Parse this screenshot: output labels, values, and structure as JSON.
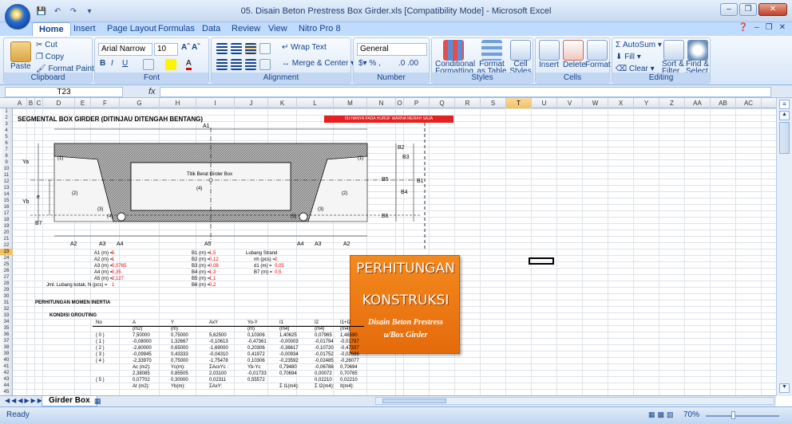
{
  "window": {
    "title": "05. Disain Beton Prestress Box Girder.xls  [Compatibility Mode] - Microsoft Excel"
  },
  "tabs": [
    "Home",
    "Insert",
    "Page Layout",
    "Formulas",
    "Data",
    "Review",
    "View",
    "Nitro Pro 8"
  ],
  "ribbon": {
    "clipboard": {
      "label": "Clipboard",
      "paste": "Paste",
      "cut": "Cut",
      "copy": "Copy",
      "format_painter": "Format Painter"
    },
    "font": {
      "label": "Font",
      "name": "Arial Narrow",
      "size": "10"
    },
    "alignment": {
      "label": "Alignment",
      "wrap": "Wrap Text",
      "merge": "Merge & Center"
    },
    "number": {
      "label": "Number",
      "format": "General"
    },
    "styles": {
      "label": "Styles",
      "cond1": "Conditional",
      "cond2": "Formatting",
      "fmt1": "Format",
      "fmt2": "as Table",
      "cell1": "Cell",
      "cell2": "Styles"
    },
    "cells": {
      "label": "Cells",
      "insert": "Insert",
      "delete": "Delete",
      "format": "Format"
    },
    "editing": {
      "label": "Editing",
      "autosum": "AutoSum",
      "fill": "Fill",
      "clear": "Clear",
      "sort1": "Sort &",
      "sort2": "Filter",
      "find1": "Find &",
      "find2": "Select"
    }
  },
  "formula_bar": {
    "name_box": "T23",
    "fx": "fx",
    "formula": ""
  },
  "columns": [
    "A",
    "B",
    "C",
    "D",
    "E",
    "F",
    "G",
    "H",
    "I",
    "J",
    "K",
    "L",
    "M",
    "N",
    "O",
    "P",
    "Q",
    "R",
    "S",
    "T",
    "U",
    "V",
    "W",
    "X",
    "Y",
    "Z",
    "AA",
    "AB",
    "AC"
  ],
  "selected_column": "T",
  "selected_row": 23,
  "sheet": {
    "title": "SEGMENTAL BOX GIRDER (DITINJAU DITENGAH BENTANG)",
    "red_note": "ISI HANYA PADA HURUF WARNA MERAH SAJA",
    "diagram": {
      "A1": "A1",
      "B1": "B1",
      "B2": "B2",
      "B3": "B3",
      "B4": "B4",
      "B5": "B5",
      "B6": "B6",
      "B7": "B7",
      "Ya": "Ya",
      "Yb": "Yb",
      "e": "e",
      "A2": "A2",
      "A3": "A3",
      "A4": "A4",
      "A5": "A5",
      "n1": "(1)",
      "n2": "(2)",
      "n3": "(3)",
      "n4": "(4)",
      "n5": "(5)",
      "centroid": "Titik Berat Girder Box"
    },
    "params_a": [
      [
        "A1 (m) =",
        "5"
      ],
      [
        "A2 (m) =",
        "1"
      ],
      [
        "A3 (m) =",
        "0,0765"
      ],
      [
        "A4 (m) =",
        "0,35"
      ],
      [
        "A5 (m) =",
        "2,127"
      ],
      [
        "Jml. Lubang kotak, N (pcs) =",
        "1"
      ]
    ],
    "params_b": [
      [
        "B1 (m) =",
        "1,5"
      ],
      [
        "B2 (m) =",
        "0,12"
      ],
      [
        "B3 (m) =",
        "0,08"
      ],
      [
        "B4 (m) =",
        "1,3"
      ],
      [
        "B5 (m) =",
        "1,1"
      ],
      [
        "B6 (m) =",
        "0,2"
      ]
    ],
    "strand": [
      [
        "Lubang Strand",
        ""
      ],
      [
        "nh (pcs) =",
        "2"
      ],
      [
        "d1 (m) =",
        "0,05"
      ],
      [
        "B7 (m) =",
        "0,5"
      ]
    ],
    "section1": "PERHITUNGAN MOMEN INERTIA",
    "section2": "KONDISI GROUTING",
    "table_header": [
      "No",
      "A",
      "Y",
      "AxY",
      "Yo-Y",
      "I1",
      "I2",
      "I1+I2"
    ],
    "table_units": [
      "",
      "(m2)",
      "(m)",
      "",
      "(m)",
      "(m4)",
      "(m4)",
      "(m4)"
    ],
    "rows": [
      [
        "( 0 )",
        "7,50000",
        "0,75000",
        "5,62500",
        "0,10306",
        "1,40625",
        "0,07965",
        "1,48590"
      ],
      [
        "( 1 )",
        "-0,08000",
        "1,32667",
        "-0,10613",
        "-0,47361",
        "-0,00003",
        "-0,01794",
        "-0,01797"
      ],
      [
        "( 2 )",
        "-2,60000",
        "0,65000",
        "-1,69000",
        "0,20306",
        "-0,36617",
        "-0,10720",
        "-0,47337"
      ],
      [
        "( 3 )",
        "-0,09945",
        "0,43333",
        "-0,04310",
        "0,41972",
        "-0,00934",
        "-0,01752",
        "-0,02686"
      ],
      [
        "( 4 )",
        "-2,33970",
        "0,75000",
        "-1,75478",
        "0,10306",
        "-0,23592",
        "-0,02485",
        "-0,26077"
      ]
    ],
    "sum1": [
      "",
      "Ac (m2):",
      "Yc(m):",
      "ΣAcxYc :",
      "Yb-Yc",
      "0,79480",
      "-0,06788",
      "0,70694"
    ],
    "sum1v": [
      "",
      "2,38085",
      "0,85505",
      "2,03100",
      "-0,01733",
      "0,70694",
      "0,00072",
      "0,70765"
    ],
    "row5": [
      "( 5 )",
      "0,07702",
      "0,30000",
      "0,02311",
      "0,55572",
      "",
      "0,02210",
      "0,02210"
    ],
    "sum2": [
      "",
      "At (m2):",
      "Yb(m):",
      "ΣAxY:",
      "",
      "Σ I1(m4):",
      "Σ I2(m4):",
      "It(m4):"
    ]
  },
  "promo": {
    "line1": "PERHITUNGAN",
    "line2": "KONSTRUKSI",
    "line3": "Disain Beton Prestress",
    "line4": "u/Box Girder"
  },
  "sheet_tab": "Girder Box",
  "status": {
    "ready": "Ready",
    "zoom": "70%"
  }
}
